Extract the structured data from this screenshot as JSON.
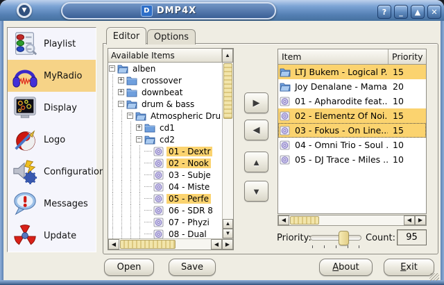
{
  "window": {
    "title": "DMP4X",
    "controls": [
      {
        "name": "help",
        "glyph": "?"
      },
      {
        "name": "minimize",
        "glyph": "_"
      },
      {
        "name": "maximize",
        "glyph": "▲"
      },
      {
        "name": "close",
        "glyph": "✕"
      }
    ]
  },
  "sidebar": {
    "items": [
      {
        "label": "Playlist",
        "icon": "playlist-icon",
        "selected": false
      },
      {
        "label": "MyRadio",
        "icon": "headphones-icon",
        "selected": true
      },
      {
        "label": "Display",
        "icon": "display-icon",
        "selected": false
      },
      {
        "label": "Logo",
        "icon": "logo-icon",
        "selected": false
      },
      {
        "label": "Configuration",
        "icon": "configuration-icon",
        "selected": false
      },
      {
        "label": "Messages",
        "icon": "messages-icon",
        "selected": false
      },
      {
        "label": "Update",
        "icon": "update-icon",
        "selected": false
      }
    ]
  },
  "tabs": [
    {
      "label": "Editor",
      "active": true
    },
    {
      "label": "Options",
      "active": false
    }
  ],
  "tree": {
    "header": "Available Items",
    "nodes": [
      {
        "level": 0,
        "expander": "-",
        "icon": "open-folder-icon",
        "label": "alben",
        "selected": false
      },
      {
        "level": 1,
        "expander": "+",
        "icon": "closed-folder-icon",
        "label": "crossover",
        "selected": false
      },
      {
        "level": 1,
        "expander": "+",
        "icon": "closed-folder-icon",
        "label": "downbeat",
        "selected": false
      },
      {
        "level": 1,
        "expander": "-",
        "icon": "open-folder-icon",
        "label": "drum & bass",
        "selected": false
      },
      {
        "level": 2,
        "expander": "-",
        "icon": "open-folder-icon",
        "label": "Atmospheric Dru",
        "selected": false
      },
      {
        "level": 3,
        "expander": "+",
        "icon": "closed-folder-icon",
        "label": "cd1",
        "selected": false
      },
      {
        "level": 3,
        "expander": "-",
        "icon": "open-folder-icon",
        "label": "cd2",
        "selected": false
      },
      {
        "level": 4,
        "expander": "",
        "icon": "cd-icon",
        "label": "01 - Dextr",
        "selected": true
      },
      {
        "level": 4,
        "expander": "",
        "icon": "cd-icon",
        "label": "02 - Nook",
        "selected": true
      },
      {
        "level": 4,
        "expander": "",
        "icon": "cd-icon",
        "label": "03 - Subje",
        "selected": false
      },
      {
        "level": 4,
        "expander": "",
        "icon": "cd-icon",
        "label": "04 - Miste",
        "selected": false
      },
      {
        "level": 4,
        "expander": "",
        "icon": "cd-icon",
        "label": "05 - Perfe",
        "selected": true
      },
      {
        "level": 4,
        "expander": "",
        "icon": "cd-icon",
        "label": "06 - SDR 8",
        "selected": false
      },
      {
        "level": 4,
        "expander": "",
        "icon": "cd-icon",
        "label": "07 - Phyzi",
        "selected": false
      },
      {
        "level": 4,
        "expander": "",
        "icon": "cd-icon",
        "label": "08 - Dual",
        "selected": false
      }
    ]
  },
  "transfer_buttons": [
    {
      "name": "move-right-button",
      "glyph": "▶"
    },
    {
      "name": "move-left-button",
      "glyph": "◀"
    },
    {
      "name": "move-up-button",
      "glyph": "▲"
    },
    {
      "name": "move-down-button",
      "glyph": "▼"
    }
  ],
  "playlist": {
    "columns": [
      "Item",
      "Priority"
    ],
    "rows": [
      {
        "icon": "open-folder-icon",
        "item": "LTJ Bukem - Logical P...",
        "priority": "15",
        "selected": true,
        "focused": false
      },
      {
        "icon": "open-folder-icon",
        "item": "Joy Denalane - Mamani",
        "priority": "20",
        "selected": false,
        "focused": false
      },
      {
        "icon": "cd-icon",
        "item": "01 - Apharodite feat....",
        "priority": "10",
        "selected": false,
        "focused": false
      },
      {
        "icon": "cd-icon",
        "item": "02 - Elementz Of Noi...",
        "priority": "15",
        "selected": true,
        "focused": false
      },
      {
        "icon": "cd-icon",
        "item": "03 - Fokus - On Line....",
        "priority": "15",
        "selected": true,
        "focused": true
      },
      {
        "icon": "cd-icon",
        "item": "04 - Omni Trio - Soul ...",
        "priority": "10",
        "selected": false,
        "focused": false
      },
      {
        "icon": "cd-icon",
        "item": "05 - DJ Trace - Miles ...",
        "priority": "10",
        "selected": false,
        "focused": false
      }
    ]
  },
  "priority_slider": {
    "label": "Priority:",
    "position_percent": 65
  },
  "count_field": {
    "label": "Count:",
    "value": "95"
  },
  "footer_buttons": [
    {
      "label": "Open",
      "mnemonic": "",
      "name": "open-button"
    },
    {
      "label": "Save",
      "mnemonic": "",
      "name": "save-button"
    },
    {
      "label": "About",
      "mnemonic": "A",
      "name": "about-button"
    },
    {
      "label": "Exit",
      "mnemonic": "E",
      "name": "exit-button"
    }
  ],
  "colors": {
    "selection": "#fbd36f",
    "sidebar_selection": "#f6d387",
    "titlebar_top": "#bdd1ec",
    "titlebar_bottom": "#46719f",
    "dialog_bg": "#efede3",
    "scrollbar_slider": "#ecd994"
  }
}
